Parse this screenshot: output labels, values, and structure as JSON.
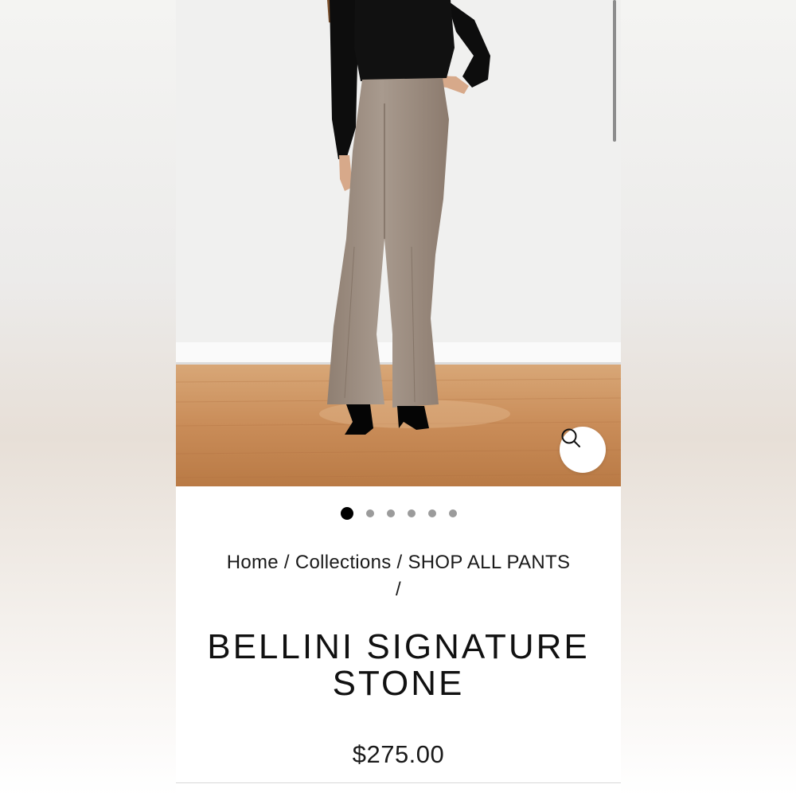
{
  "product": {
    "image_alt": "Model wearing stone flared pants",
    "carousel": {
      "total": 6,
      "active": 0
    },
    "zoom_icon": "search-icon",
    "breadcrumb": {
      "items": [
        "Home",
        "Collections",
        "SHOP ALL PANTS"
      ],
      "separator": "/"
    },
    "title_line1": "BELLINI SIGNATURE",
    "title_line2": "STONE",
    "price": "$275.00"
  },
  "colors": {
    "pants": "#9e8e81",
    "shirt": "#0d0d0d",
    "floor": "#c88d5a",
    "wall": "#f0f0ef"
  }
}
